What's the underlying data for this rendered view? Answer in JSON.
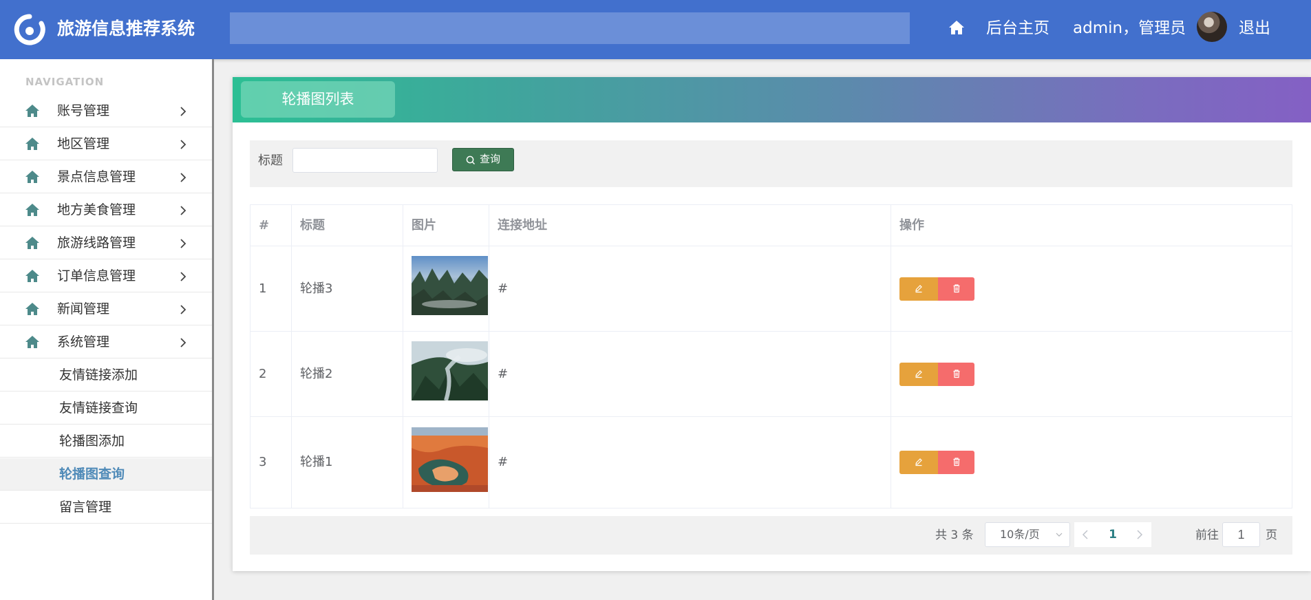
{
  "app": {
    "title": "旅游信息推荐系统"
  },
  "topnav": {
    "home_label": "后台主页",
    "user_label": "admin，管理员",
    "logout_label": "退出"
  },
  "sidebar": {
    "heading": "NAVIGATION",
    "menus": [
      {
        "label": "账号管理"
      },
      {
        "label": "地区管理"
      },
      {
        "label": "景点信息管理"
      },
      {
        "label": "地方美食管理"
      },
      {
        "label": "旅游线路管理"
      },
      {
        "label": "订单信息管理"
      },
      {
        "label": "新闻管理"
      },
      {
        "label": "系统管理"
      }
    ],
    "submenus": [
      {
        "label": "友情链接添加"
      },
      {
        "label": "友情链接查询"
      },
      {
        "label": "轮播图添加"
      },
      {
        "label": "轮播图查询",
        "active": true
      },
      {
        "label": "留言管理"
      }
    ]
  },
  "card": {
    "tab_title": "轮播图列表"
  },
  "filter": {
    "label": "标题",
    "value": "",
    "button_label": "查询"
  },
  "table": {
    "columns": [
      "#",
      "标题",
      "图片",
      "连接地址",
      "操作"
    ],
    "rows": [
      {
        "index": "1",
        "title": "轮播3",
        "image": "karst-mountains-aerial",
        "link": "#"
      },
      {
        "index": "2",
        "title": "轮播2",
        "image": "river-valley-fog",
        "link": "#"
      },
      {
        "index": "3",
        "title": "轮播1",
        "image": "red-canyon-river",
        "link": "#"
      }
    ]
  },
  "pagination": {
    "total_text": "共 3 条",
    "page_size": "10条/页",
    "current_page": "1",
    "goto_label": "前往",
    "goto_value": "1",
    "goto_unit": "页"
  },
  "colors": {
    "header": "#4270cd",
    "accent_green": "#3e7a55",
    "edit": "#e6a23c",
    "delete": "#f56c6c"
  }
}
